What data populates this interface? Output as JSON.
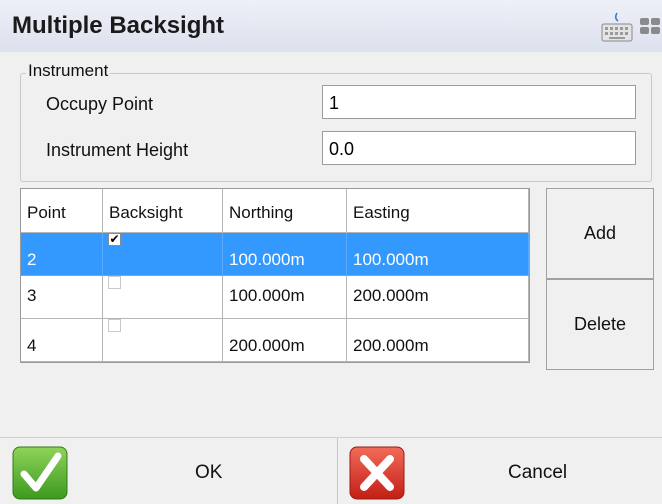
{
  "title": "Multiple Backsight",
  "header_icons": [
    "keyboard-icon",
    "grid-icon"
  ],
  "instrument": {
    "legend": "Instrument",
    "occupy_point_label": "Occupy Point",
    "occupy_point_value": "1",
    "height_label": "Instrument Height",
    "height_value": "0.0"
  },
  "table": {
    "columns": [
      "Point",
      "Backsight",
      "Northing",
      "Easting"
    ],
    "rows": [
      {
        "point": "2",
        "backsight": true,
        "northing": "100.000m",
        "easting": "100.000m",
        "selected": true
      },
      {
        "point": "3",
        "backsight": false,
        "northing": "100.000m",
        "easting": "200.000m",
        "selected": false
      },
      {
        "point": "4",
        "backsight": false,
        "northing": "200.000m",
        "easting": "200.000m",
        "selected": false
      }
    ]
  },
  "buttons": {
    "add": "Add",
    "delete": "Delete",
    "ok": "OK",
    "cancel": "Cancel"
  },
  "colors": {
    "selection": "#3399ff",
    "ok_green": "#4caf2e",
    "cancel_red": "#e03a2c"
  }
}
